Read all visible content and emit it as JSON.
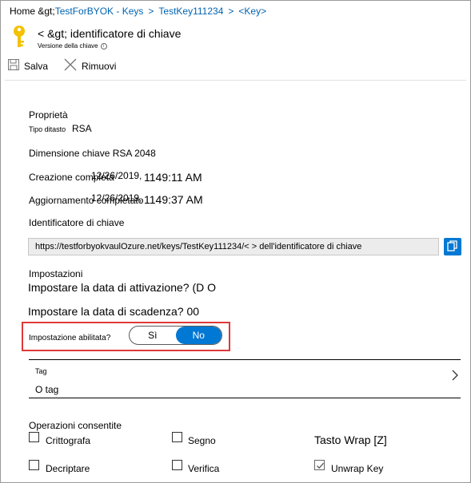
{
  "breadcrumb": {
    "home": "Home &gt;",
    "items": [
      "TestForBYOK - Keys",
      "TestKey111234",
      "<Key"
    ],
    "separator": ">"
  },
  "header": {
    "title": "< &gt; identificatore di chiave",
    "subtitle": "Versione della chiave",
    "info_icon_text": "i",
    "icon": "key-icon"
  },
  "toolbar": {
    "save_label": "Salva",
    "remove_label": "Rimuovi"
  },
  "properties": {
    "heading": "Proprietà",
    "key_type_label": "Tipo ditasto",
    "key_type_value": "RSA",
    "key_size": "Dimensione chiave RSA 2048",
    "created_label": "Creazione completa",
    "created_date": "12/26/2019,",
    "created_time": "1149:11 AM",
    "updated_label": "Aggiornamento completato",
    "updated_date": "12/26/2019,",
    "updated_time": "1149:37 AM",
    "key_id_label": "Identificatore di chiave",
    "key_id_value": "https://testforbyokvaulOzure.net/keys/TestKey111234/< > dell'identificatore di chiave"
  },
  "settings": {
    "heading": "Impostazioni",
    "activation": "Impostare la data di attivazione? (D O",
    "expiration": "Impostare la data di scadenza? 00",
    "enabled_label": "Impostazione abilitata?",
    "toggle_yes": "Sì",
    "toggle_no": "No",
    "toggle_selected": "No"
  },
  "tags": {
    "label": "Tag",
    "value": "O tag"
  },
  "operations": {
    "heading": "Operazioni consentite",
    "items": [
      {
        "label": "Crittografa",
        "checked": false
      },
      {
        "label": "Segno",
        "checked": false
      },
      {
        "label": "Tasto Wrap [Z]",
        "checked": false
      },
      {
        "label": "Decriptare",
        "checked": false
      },
      {
        "label": "Verifica",
        "checked": false
      },
      {
        "label": "Unwrap Key",
        "checked": true
      }
    ]
  },
  "colors": {
    "link": "#0063b1",
    "accent": "#0078d4",
    "highlight": "#e03838",
    "key_icon": "#f2c200"
  }
}
